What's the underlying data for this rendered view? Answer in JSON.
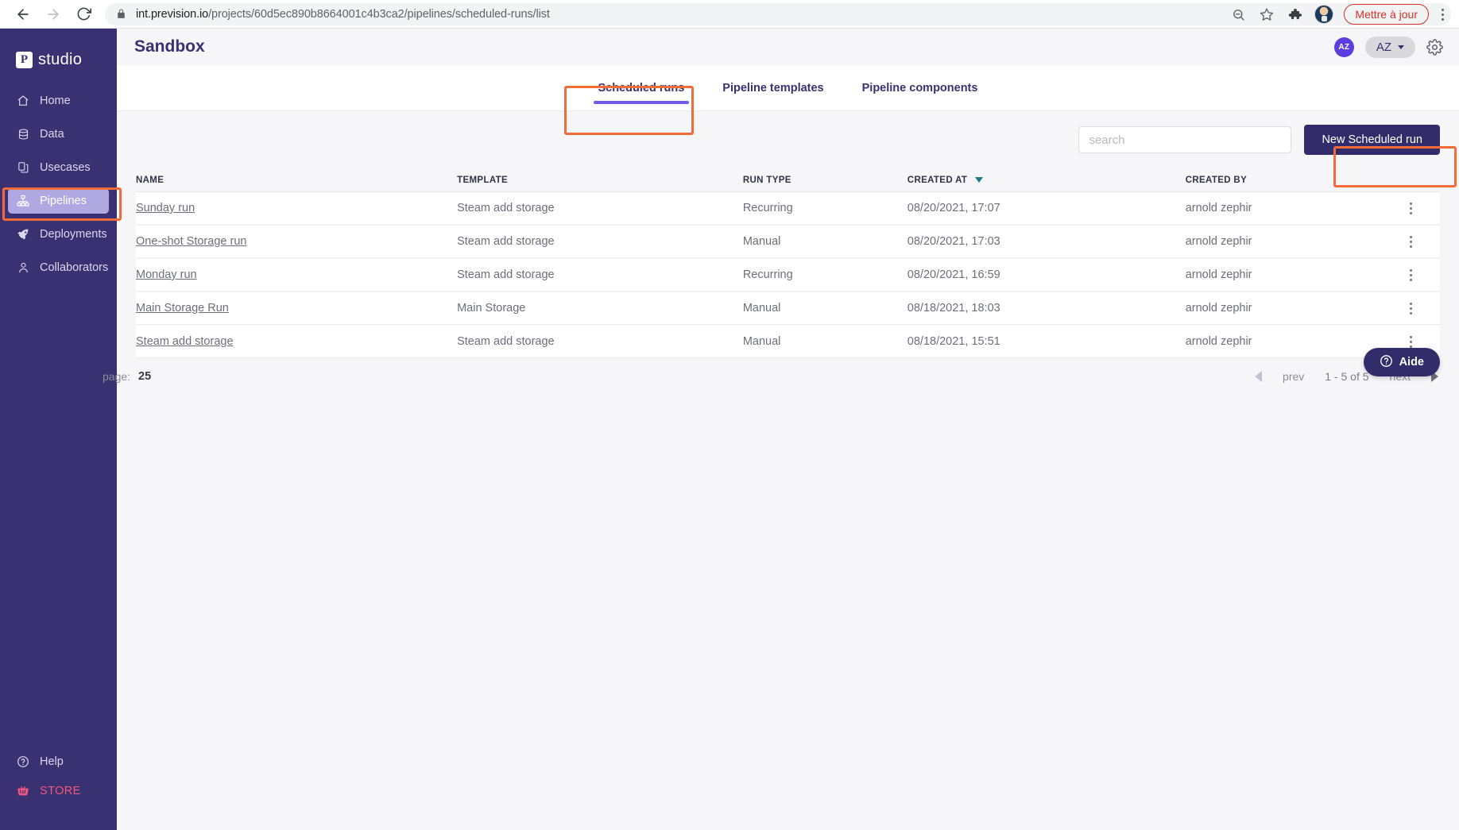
{
  "browser": {
    "url_host": "int.prevision.io",
    "url_path": "/projects/60d5ec890b8664001c4b3ca2/pipelines/scheduled-runs/list",
    "back_icon": "back-arrow-icon",
    "forward_icon": "forward-arrow-icon",
    "reload_icon": "reload-icon",
    "lock_icon": "lock-icon",
    "zoom_icon": "zoom-out-icon",
    "bookmark_icon": "star-icon",
    "extensions_icon": "puzzle-piece-icon",
    "profile_icon": "profile-avatar-icon",
    "update_label": "Mettre à jour",
    "menu_icon": "three-dot-menu-icon"
  },
  "sidebar": {
    "brand_mark": "P",
    "brand_name": "studio",
    "items": [
      {
        "label": "Home",
        "icon": "home-icon"
      },
      {
        "label": "Data",
        "icon": "database-icon"
      },
      {
        "label": "Usecases",
        "icon": "copy-documents-icon"
      },
      {
        "label": "Pipelines",
        "icon": "sitemap-icon"
      },
      {
        "label": "Deployments",
        "icon": "rocket-icon"
      },
      {
        "label": "Collaborators",
        "icon": "person-icon"
      }
    ],
    "active_item": "Pipelines",
    "bottom_items": [
      {
        "label": "Help",
        "icon": "question-circle-icon"
      },
      {
        "label": "STORE",
        "icon": "basket-icon"
      }
    ]
  },
  "header": {
    "title": "Sandbox",
    "avatar_initials": "AZ",
    "user_menu_label": "AZ",
    "settings_icon": "gear-icon"
  },
  "tabs": [
    {
      "label": "Scheduled runs",
      "active": true
    },
    {
      "label": "Pipeline templates",
      "active": false
    },
    {
      "label": "Pipeline components",
      "active": false
    }
  ],
  "toolbar": {
    "search_placeholder": "search",
    "search_value": "",
    "new_run_label": "New Scheduled run"
  },
  "table": {
    "columns": [
      {
        "label": "NAME",
        "sorted": false
      },
      {
        "label": "TEMPLATE",
        "sorted": false
      },
      {
        "label": "RUN TYPE",
        "sorted": false
      },
      {
        "label": "CREATED AT",
        "sorted": true
      },
      {
        "label": "CREATED BY",
        "sorted": false
      }
    ],
    "rows": [
      {
        "name": "Sunday run",
        "template": "Steam add storage",
        "run_type": "Recurring",
        "created_at": "08/20/2021, 17:07",
        "created_by": "arnold zephir"
      },
      {
        "name": "One-shot Storage run",
        "template": "Steam add storage",
        "run_type": "Manual",
        "created_at": "08/20/2021, 17:03",
        "created_by": "arnold zephir"
      },
      {
        "name": "Monday run",
        "template": "Steam add storage",
        "run_type": "Recurring",
        "created_at": "08/20/2021, 16:59",
        "created_by": "arnold zephir"
      },
      {
        "name": "Main Storage Run",
        "template": "Main Storage",
        "run_type": "Manual",
        "created_at": "08/18/2021, 18:03",
        "created_by": "arnold zephir"
      },
      {
        "name": "Steam add storage",
        "template": "Steam add storage",
        "run_type": "Manual",
        "created_at": "08/18/2021, 15:51",
        "created_by": "arnold zephir"
      }
    ],
    "row_menu_icon": "three-dot-vertical-icon"
  },
  "pagination": {
    "rows_per_page_label": "page:",
    "rows_per_page_value": "25",
    "prev_label": "prev",
    "range_label": "1 - 5 of 5",
    "next_label": "next"
  },
  "help_widget": {
    "label": "Aide",
    "icon": "question-circle-icon"
  },
  "annotations": {
    "color": "#f26b38",
    "targets": [
      "sidebar-item-pipelines",
      "tab-scheduled-runs",
      "new-scheduled-run-button"
    ]
  }
}
